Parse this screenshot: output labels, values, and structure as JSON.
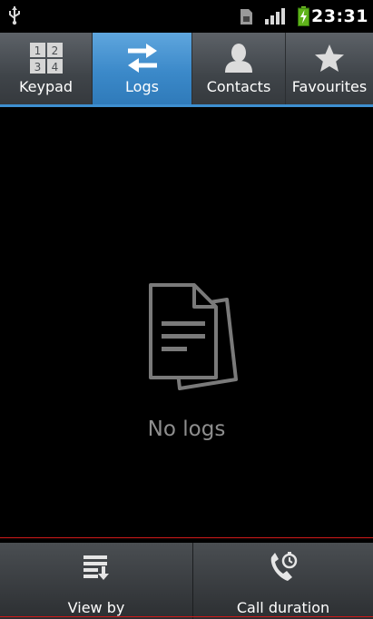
{
  "status_bar": {
    "time": "23:31",
    "icons": [
      "usb-icon",
      "sim-icon",
      "signal-icon",
      "battery-charging-icon"
    ]
  },
  "tabs": [
    {
      "label": "Keypad",
      "icon": "keypad-icon",
      "active": false
    },
    {
      "label": "Logs",
      "icon": "swap-arrows-icon",
      "active": true
    },
    {
      "label": "Contacts",
      "icon": "person-icon",
      "active": false
    },
    {
      "label": "Favourites",
      "icon": "star-icon",
      "active": false
    }
  ],
  "empty_state": {
    "icon": "documents-icon",
    "text": "No logs"
  },
  "bottom_actions": [
    {
      "label": "View by",
      "icon": "view-by-list-icon"
    },
    {
      "label": "Call duration",
      "icon": "call-duration-icon"
    }
  ],
  "colors": {
    "active_tab": "#3b89c9",
    "tab_bar": "#3f4449",
    "background": "#000000",
    "empty_text": "#8e8e8e"
  }
}
